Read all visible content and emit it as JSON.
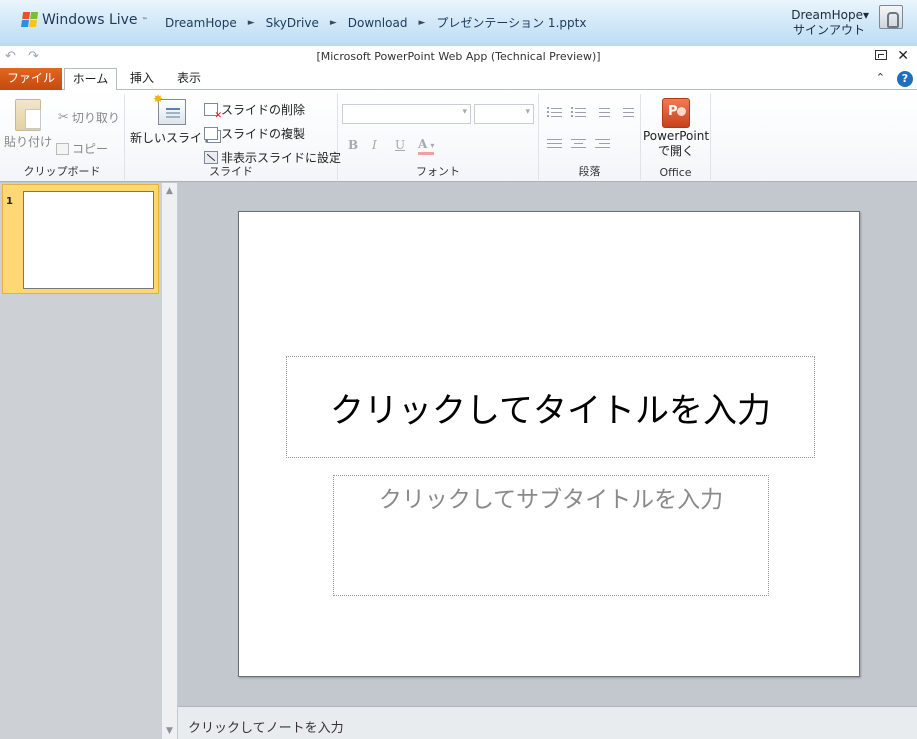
{
  "header": {
    "brand": "Windows Live",
    "brand_tm": "™",
    "breadcrumb": [
      "DreamHope",
      "SkyDrive",
      "Download",
      "プレゼンテーション 1.pptx"
    ],
    "user_name": "DreamHope",
    "sign_out": "サインアウト"
  },
  "window": {
    "title": "[Microsoft PowerPoint Web App (Technical Preview)]"
  },
  "tabs": {
    "file": "ファイル",
    "home": "ホーム",
    "insert": "挿入",
    "view": "表示"
  },
  "ribbon": {
    "clipboard": {
      "label": "クリップボード",
      "paste": "貼り付け",
      "cut": "切り取り",
      "copy": "コピー"
    },
    "slides": {
      "label": "スライド",
      "new_slide": "新しいスライド",
      "delete_slide": "スライドの削除",
      "duplicate_slide": "スライドの複製",
      "hide_slide": "非表示スライドに設定"
    },
    "font": {
      "label": "フォント",
      "font_name": "",
      "font_size": "",
      "bold": "B",
      "italic": "I",
      "underline": "U",
      "font_color": "A"
    },
    "paragraph": {
      "label": "段落"
    },
    "office": {
      "label": "Office",
      "open_line1": "PowerPoint",
      "open_line2": "で開く"
    }
  },
  "thumbnails": [
    {
      "number": "1"
    }
  ],
  "slide": {
    "title_placeholder": "クリックしてタイトルを入力",
    "subtitle_placeholder": "クリックしてサブタイトルを入力"
  },
  "notes": {
    "placeholder": "クリックしてノートを入力"
  },
  "colors": {
    "file_tab": "#d5561a",
    "selected_thumb": "#ffd773",
    "header_bg": "#cfe7f8"
  }
}
